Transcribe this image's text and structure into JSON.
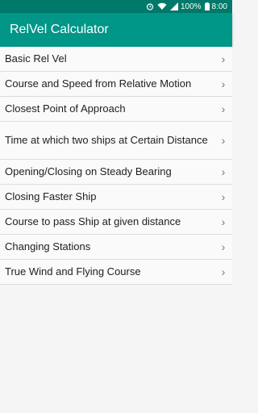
{
  "status_bar": {
    "battery_percent": "100%",
    "time": "8:00"
  },
  "app_bar": {
    "title": "RelVel Calculator"
  },
  "menu": {
    "items": [
      {
        "label": "Basic Rel Vel",
        "icon": "chevron-right-icon"
      },
      {
        "label": "Course and Speed from Relative Motion",
        "icon": "chevron-right-icon"
      },
      {
        "label": "Closest Point of Approach",
        "icon": "chevron-right-icon"
      },
      {
        "label": "Time at which two ships at Certain Distance",
        "icon": "chevron-right-icon"
      },
      {
        "label": "Opening/Closing on Steady Bearing",
        "icon": "chevron-right-icon"
      },
      {
        "label": "Closing Faster Ship",
        "icon": "chevron-right-icon"
      },
      {
        "label": "Course to pass Ship at given distance",
        "icon": "chevron-right-icon"
      },
      {
        "label": "Changing Stations",
        "icon": "chevron-right-icon"
      },
      {
        "label": "True Wind and Flying Course",
        "icon": "chevron-right-icon"
      }
    ]
  },
  "colors": {
    "status_bar": "#00796b",
    "app_bar": "#009688",
    "background": "#fafafa"
  }
}
